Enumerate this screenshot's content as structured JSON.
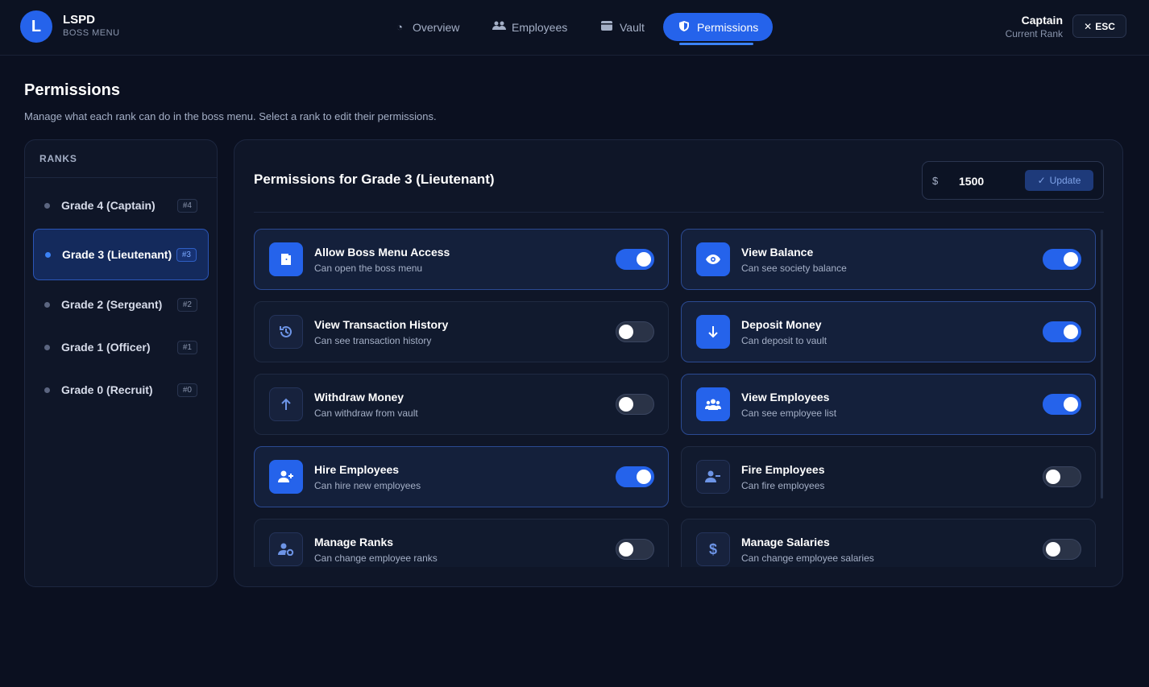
{
  "header": {
    "brand_title": "LSPD",
    "brand_subtitle": "BOSS MENU",
    "tabs": [
      {
        "label": "Overview",
        "icon": "pie-chart-icon"
      },
      {
        "label": "Employees",
        "icon": "users-icon"
      },
      {
        "label": "Vault",
        "icon": "wallet-icon"
      },
      {
        "label": "Permissions",
        "icon": "shield-icon",
        "active": true
      }
    ],
    "user_rank": "Captain",
    "user_rank_caption": "Current Rank",
    "esc_label": "ESC"
  },
  "page": {
    "title": "Permissions",
    "description": "Manage what each rank can do in the boss menu. Select a rank to edit their permissions."
  },
  "ranks": {
    "header": "RANKS",
    "items": [
      {
        "label": "Grade 4 (Captain)",
        "badge": "#4"
      },
      {
        "label": "Grade 3 (Lieutenant)",
        "badge": "#3",
        "active": true
      },
      {
        "label": "Grade 2 (Sergeant)",
        "badge": "#2"
      },
      {
        "label": "Grade 1 (Officer)",
        "badge": "#1"
      },
      {
        "label": "Grade 0 (Recruit)",
        "badge": "#0"
      }
    ]
  },
  "permissions": {
    "title": "Permissions for Grade 3 (Lieutenant)",
    "salary_currency": "$",
    "salary_value": "1500",
    "update_label": "Update",
    "items": [
      {
        "name": "Allow Boss Menu Access",
        "desc": "Can open the boss menu",
        "enabled": true,
        "icon": "door-icon"
      },
      {
        "name": "View Balance",
        "desc": "Can see society balance",
        "enabled": true,
        "icon": "eye-icon"
      },
      {
        "name": "View Transaction History",
        "desc": "Can see transaction history",
        "enabled": false,
        "icon": "history-icon"
      },
      {
        "name": "Deposit Money",
        "desc": "Can deposit to vault",
        "enabled": true,
        "icon": "arrow-down-icon"
      },
      {
        "name": "Withdraw Money",
        "desc": "Can withdraw from vault",
        "enabled": false,
        "icon": "arrow-up-icon"
      },
      {
        "name": "View Employees",
        "desc": "Can see employee list",
        "enabled": true,
        "icon": "users-icon"
      },
      {
        "name": "Hire Employees",
        "desc": "Can hire new employees",
        "enabled": true,
        "icon": "user-plus-icon"
      },
      {
        "name": "Fire Employees",
        "desc": "Can fire employees",
        "enabled": false,
        "icon": "user-minus-icon"
      },
      {
        "name": "Manage Ranks",
        "desc": "Can change employee ranks",
        "enabled": false,
        "icon": "user-cog-icon"
      },
      {
        "name": "Manage Salaries",
        "desc": "Can change employee salaries",
        "enabled": false,
        "icon": "dollar-icon"
      }
    ]
  },
  "colors": {
    "accent": "#2563eb",
    "background": "#0b1020",
    "panel": "#0f1628"
  }
}
